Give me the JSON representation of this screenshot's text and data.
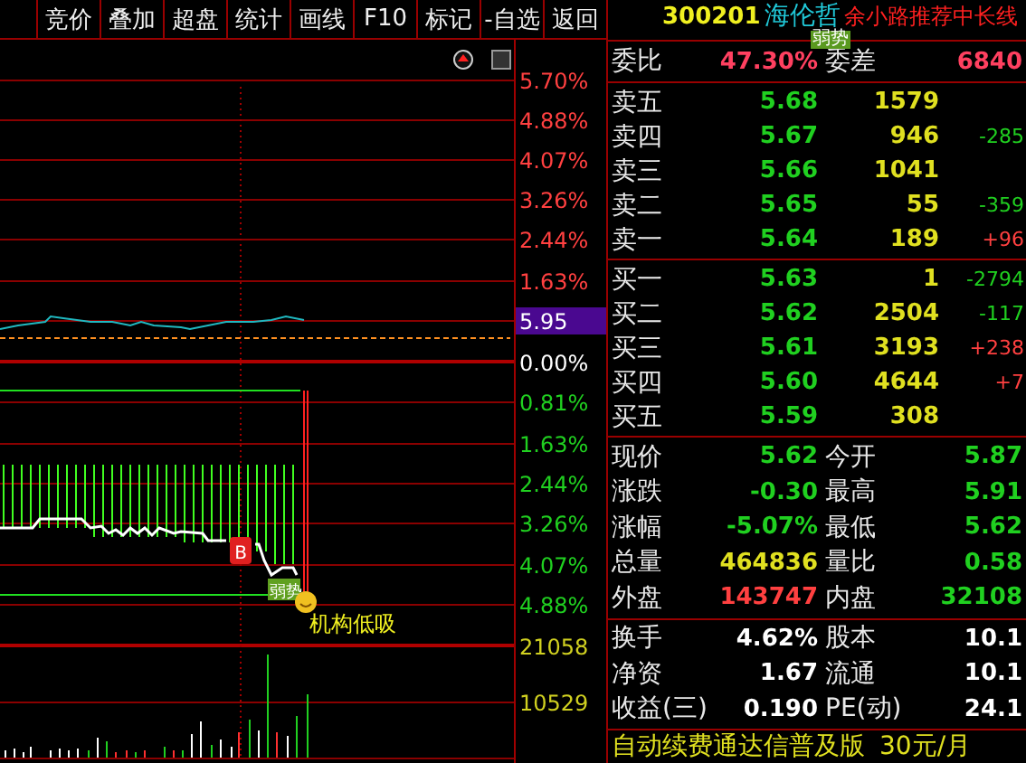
{
  "toolbar": [
    {
      "label": "竞价"
    },
    {
      "label": "叠加"
    },
    {
      "label": "超盘"
    },
    {
      "label": "统计"
    },
    {
      "label": "画线"
    },
    {
      "label": "F10"
    },
    {
      "label": "标记"
    },
    {
      "label": "-自选"
    },
    {
      "label": "返回"
    }
  ],
  "chart": {
    "axis_labels": [
      {
        "text": "5.70%",
        "color": "#ff4040"
      },
      {
        "text": "4.88%",
        "color": "#ff4040"
      },
      {
        "text": "4.07%",
        "color": "#ff4040"
      },
      {
        "text": "3.26%",
        "color": "#ff4040"
      },
      {
        "text": "2.44%",
        "color": "#ff4040"
      },
      {
        "text": "1.63%",
        "color": "#ff4040"
      },
      {
        "text": "0.00%",
        "color": "#ffffff"
      },
      {
        "text": "0.81%",
        "color": "#20d020"
      },
      {
        "text": "1.63%",
        "color": "#20d020"
      },
      {
        "text": "2.44%",
        "color": "#20d020"
      },
      {
        "text": "3.26%",
        "color": "#20d020"
      },
      {
        "text": "4.07%",
        "color": "#20d020"
      },
      {
        "text": "4.88%",
        "color": "#20d020"
      }
    ],
    "price_tag": "5.95",
    "marker": "B",
    "badge": "弱势",
    "note": "机构低吸",
    "volume_labels": [
      "21058",
      "10529"
    ]
  },
  "quote": {
    "code": "300201",
    "name": "海伦哲",
    "badge": "弱势",
    "promo": "余小路推荐中长线",
    "ratio": {
      "label": "委比",
      "value": "47.30%",
      "label2": "委差",
      "value2": "6840"
    },
    "asks": [
      {
        "label": "卖五",
        "price": "5.68",
        "volume": "1579"
      },
      {
        "label": "卖四",
        "price": "5.67",
        "volume": "946",
        "change": "-285",
        "color": "#20d020"
      },
      {
        "label": "卖三",
        "price": "5.66",
        "volume": "1041"
      },
      {
        "label": "卖二",
        "price": "5.65",
        "volume": "55",
        "change": "-359",
        "color": "#20d020"
      },
      {
        "label": "卖一",
        "price": "5.64",
        "volume": "189",
        "change": "+96",
        "color": "#ff4040"
      }
    ],
    "bids": [
      {
        "label": "买一",
        "price": "5.63",
        "volume": "1",
        "change": "-2794",
        "color": "#20d020"
      },
      {
        "label": "买二",
        "price": "5.62",
        "volume": "2504",
        "change": "-117",
        "color": "#20d020"
      },
      {
        "label": "买三",
        "price": "5.61",
        "volume": "3193",
        "change": "+238",
        "color": "#ff4040"
      },
      {
        "label": "买四",
        "price": "5.60",
        "volume": "4644",
        "change": "+7",
        "color": "#ff4040"
      },
      {
        "label": "买五",
        "price": "5.59",
        "volume": "308"
      }
    ],
    "stats": [
      {
        "label": "现价",
        "value": "5.62",
        "color": "#20d020"
      },
      {
        "label": "今开",
        "value": "5.87",
        "color": "#20d020"
      },
      {
        "label": "涨跌",
        "value": "-0.30",
        "color": "#20d020"
      },
      {
        "label": "最高",
        "value": "5.91",
        "color": "#20d020"
      },
      {
        "label": "涨幅",
        "value": "-5.07%",
        "color": "#20d020"
      },
      {
        "label": "最低",
        "value": "5.62",
        "color": "#20d020"
      },
      {
        "label": "总量",
        "value": "464836",
        "color": "#e0e020"
      },
      {
        "label": "量比",
        "value": "0.58",
        "color": "#20d020"
      },
      {
        "label": "外盘",
        "value": "143747",
        "color": "#ff4040"
      },
      {
        "label": "内盘",
        "value": "32108",
        "color": "#20d020"
      }
    ],
    "fundamentals": [
      {
        "label": "换手",
        "value": "4.62%",
        "color": "#ffffff"
      },
      {
        "label": "股本",
        "value": "10.1",
        "color": "#ffffff"
      },
      {
        "label": "净资",
        "value": "1.67",
        "color": "#ffffff"
      },
      {
        "label": "流通",
        "value": "10.1",
        "color": "#ffffff"
      },
      {
        "label": "收益(三)",
        "value": "0.190",
        "color": "#ffffff"
      },
      {
        "label": "PE(动)",
        "value": "24.1",
        "color": "#ffffff"
      }
    ],
    "footer": {
      "text": "自动续费通达信普及版",
      "price": "30元/月"
    }
  }
}
